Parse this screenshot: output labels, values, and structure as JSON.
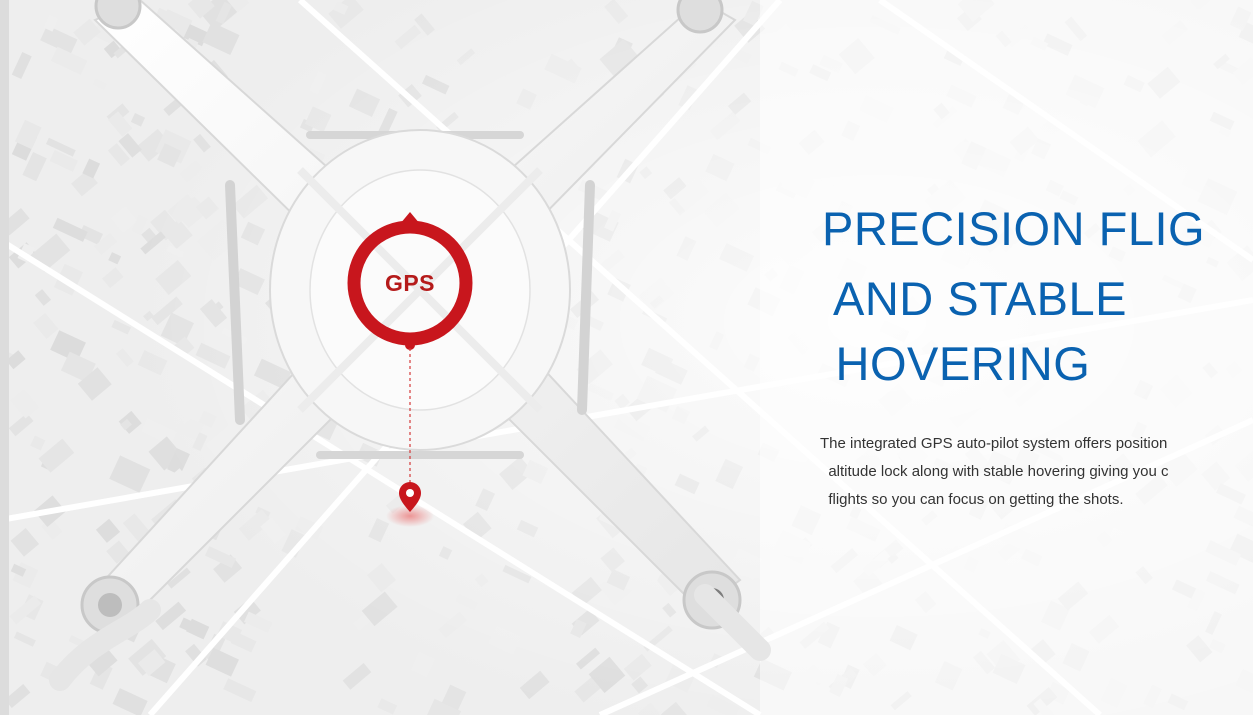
{
  "gps_badge": {
    "label": "GPS",
    "color": "#c8161d"
  },
  "feature": {
    "heading_lines": [
      "PRECISION FLIG",
      " AND STABLE",
      " HOVERING"
    ],
    "heading_color": "#0a62b0",
    "description_lines": [
      "The integrated GPS auto-pilot system offers position",
      "  altitude lock along with stable hovering giving you c",
      "  flights so you can focus on getting the shots."
    ]
  },
  "icons": [
    "gps-ring-icon",
    "location-pin-icon"
  ]
}
